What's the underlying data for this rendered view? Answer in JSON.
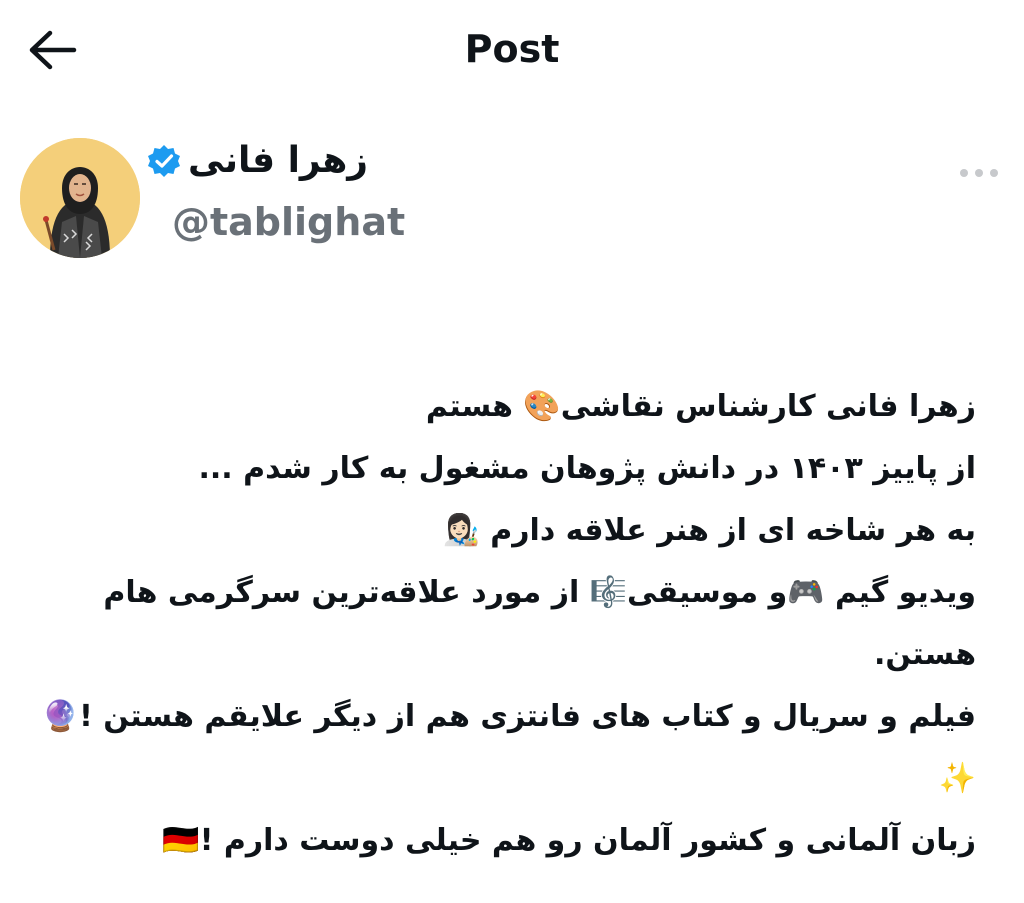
{
  "header": {
    "back_icon": "arrow-left-icon",
    "title": "Post"
  },
  "author": {
    "avatar_icon": "avatar-illustration",
    "name": "زهرا فانی",
    "verified_icon": "verified-badge-icon",
    "handle": "@tablighat"
  },
  "more_icon": "more-horizontal-icon",
  "post": {
    "lines": [
      "زهرا فانی کارشناس نقاشی🎨 هستم",
      "از پاییز ۱۴۰۳ در دانش پژوهان مشغول به کار شدم ...",
      "به هر شاخه ای از هنر علاقه دارم 👩🏻‍🎨",
      "ویدیو گیم 🎮و موسیقی🎼 از مورد علاقه‌ترین سرگرمی هام",
      "هستن.",
      "فیلم و سریال و کتاب های فانتزی هم از دیگر علایقم هستن !🔮",
      "✨",
      "زبان آلمانی و کشور آلمان رو هم خیلی دوست دارم !🇩🇪"
    ]
  },
  "colors": {
    "text": "#0f1419",
    "muted": "#6a7178",
    "verified": "#1d9bf0",
    "avatar_bg": "#f4cf7a"
  }
}
